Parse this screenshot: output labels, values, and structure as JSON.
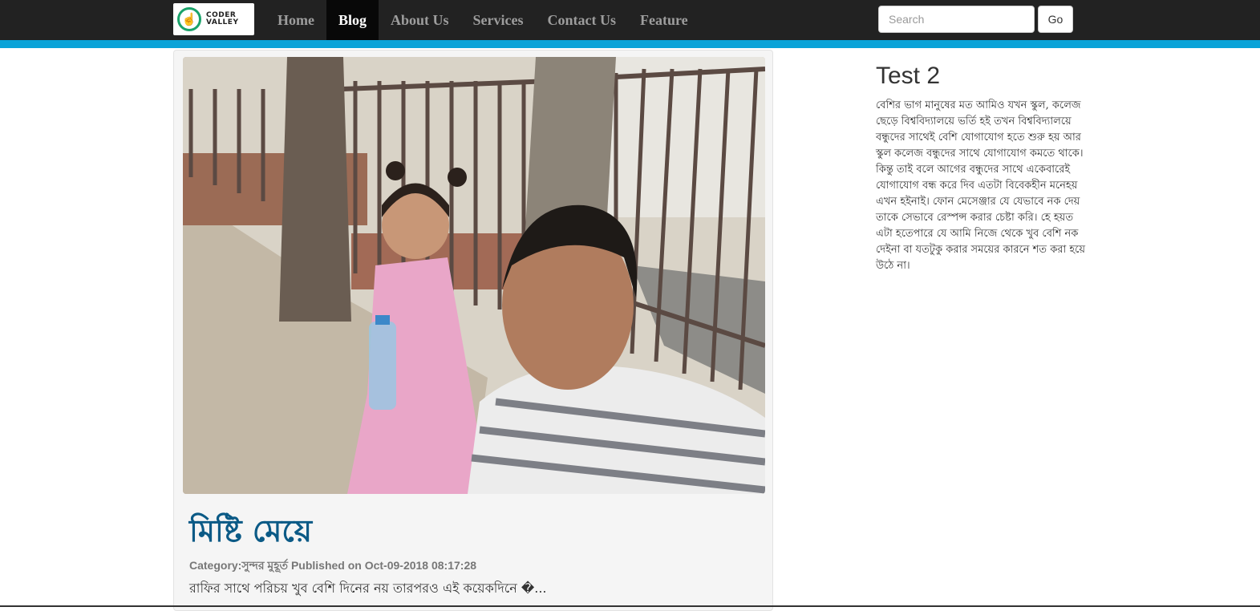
{
  "logo": {
    "line1": "CODER",
    "line2": "VALLEY",
    "icon": "hand-pointer-icon"
  },
  "nav": {
    "items": [
      {
        "label": "Home"
      },
      {
        "label": "Blog"
      },
      {
        "label": "About Us"
      },
      {
        "label": "Services"
      },
      {
        "label": "Contact Us"
      },
      {
        "label": "Feature"
      }
    ],
    "active": "Blog"
  },
  "search": {
    "placeholder": "Search",
    "value": "",
    "button_label": "Go"
  },
  "post": {
    "title": "মিষ্টি মেয়ে",
    "meta": "Category:সুন্দর মুহূর্ত Published on Oct-09-2018 08:17:28",
    "excerpt": "রাফির সাথে পরিচয় খুব বেশি দিনের নয় তারপরও এই কয়েকদিনে �..."
  },
  "sidebar": {
    "title": "Test 2",
    "text": "বেশির ভাগ মানুষের মত আমিও যখন স্কুল, কলেজ ছেড়ে বিশ্ববিদ্যালয়ে ভর্তি হই তখন বিশ্ববিদ্যালয়ে বন্ধুদের সাথেই বেশি যোগাযোগ হতে শুরু হয় আর স্কুল কলেজ বন্ধুদের সাথে যোগাযোগ কমতে থাকে। কিন্তু তাই বলে আগের বন্ধুদের সাথে একেবারেই যোগাযোগ বন্ধ করে দিব এতটা বিবেকহীন মনেহয় এখন হইনাই। ফোন মেসেঞ্জার যে যেভাবে নক দেয় তাকে সেভাবে রেস্পন্স করার চেষ্টা করি। হে হয়ত এটা হতেপারে যে আমি নিজে থেকে খুব বেশি নক দেইনা বা যতটুকু করার সময়ের কারনে শত করা হয়ে উঠে না।"
  },
  "colors": {
    "navbar": "#222222",
    "accent": "#0aa3d8",
    "title": "#0b5a86"
  }
}
